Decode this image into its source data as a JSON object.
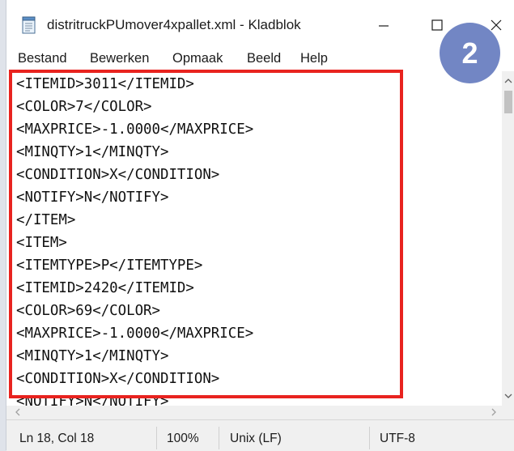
{
  "window": {
    "title": "distritruckPUmover4xpallet.xml - Kladblok"
  },
  "menu": [
    "Bestand",
    "Bewerken",
    "Opmaak",
    "Beeld",
    "Help"
  ],
  "editor": {
    "lines": [
      "<ITEMID>3011</ITEMID>",
      "<COLOR>7</COLOR>",
      "<MAXPRICE>-1.0000</MAXPRICE>",
      "<MINQTY>1</MINQTY>",
      "<CONDITION>X</CONDITION>",
      "<NOTIFY>N</NOTIFY>",
      "</ITEM>",
      "<ITEM>",
      "<ITEMTYPE>P</ITEMTYPE>",
      "<ITEMID>2420</ITEMID>",
      "<COLOR>69</COLOR>",
      "<MAXPRICE>-1.0000</MAXPRICE>",
      "<MINQTY>1</MINQTY>",
      "<CONDITION>X</CONDITION>",
      "<NOTIFY>N</NOTIFY>"
    ]
  },
  "status": {
    "position": "Ln 18, Col 18",
    "zoom": "100%",
    "line_ending": "Unix (LF)",
    "encoding": "UTF-8"
  },
  "badge": {
    "number": "2"
  },
  "colors": {
    "highlight": "#e8231f",
    "badge": "#7286c4"
  }
}
